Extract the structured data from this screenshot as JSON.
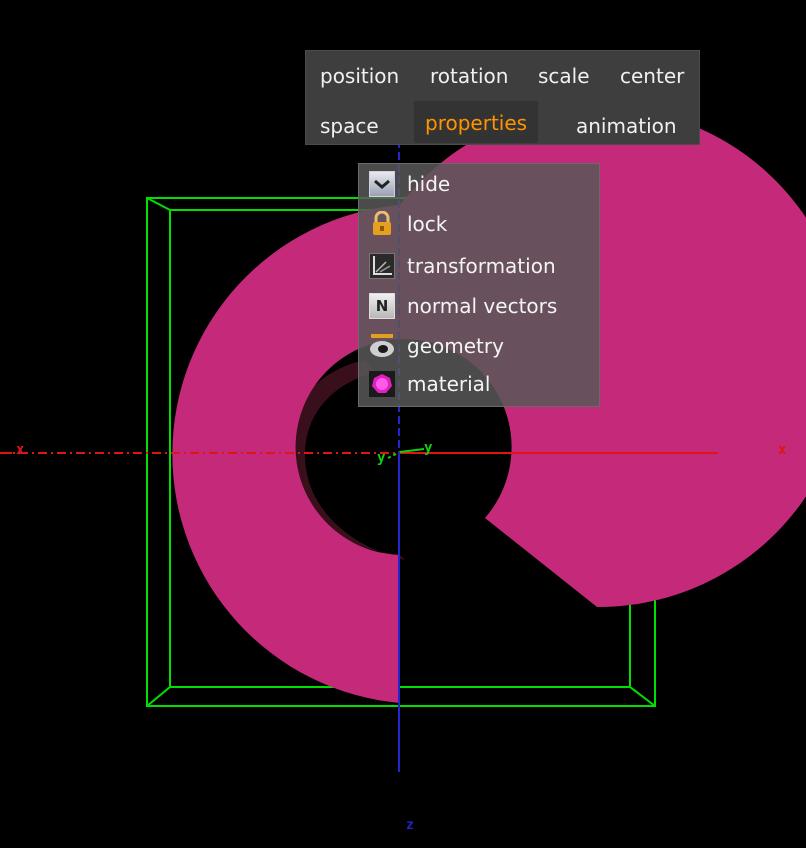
{
  "colors": {
    "background": "#000000",
    "shape_fill": "#c42a79",
    "shape_shadow": "#3a0f1c",
    "bounding_box": "#00e000",
    "x_axis": "#e01414",
    "y_axis": "#10d010",
    "z_axis": "#2424d0",
    "menu_bg": "#3e3e3e",
    "menu_text": "#f0f0f0",
    "menu_active_text": "#ff9400"
  },
  "axes": {
    "x_left": "x",
    "x_right": "x",
    "y_left": "y",
    "y_right": "y",
    "z_bottom": "z"
  },
  "menu": {
    "row1": [
      "position",
      "rotation",
      "scale",
      "center"
    ],
    "row2": [
      "space",
      "properties",
      "animation"
    ],
    "active": "properties"
  },
  "properties_menu": {
    "items": [
      {
        "label": "hide",
        "icon": "hide-icon"
      },
      {
        "label": "lock",
        "icon": "lock-icon"
      },
      {
        "label": "transformation",
        "icon": "transformation-icon"
      },
      {
        "label": "normal vectors",
        "icon": "normal-vectors-icon",
        "glyph": "N"
      },
      {
        "label": "geometry",
        "icon": "geometry-icon"
      },
      {
        "label": "material",
        "icon": "material-icon"
      }
    ]
  }
}
